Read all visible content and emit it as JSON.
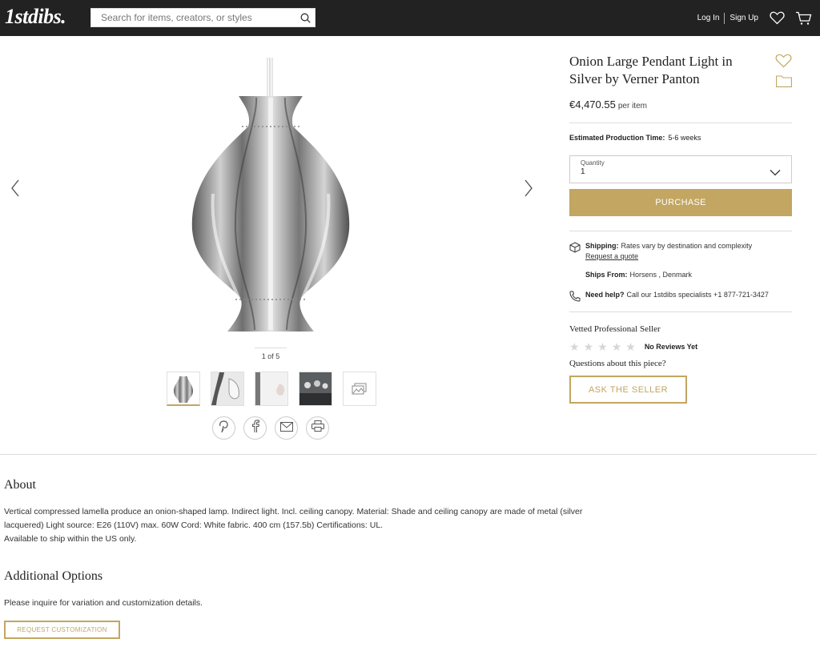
{
  "header": {
    "logo": "1stdibs.",
    "search_placeholder": "Search for items, creators, or styles",
    "login": "Log In",
    "signup": "Sign Up"
  },
  "gallery": {
    "counter": "1 of 5",
    "thumbnails": [
      "thumbnail-1",
      "thumbnail-2",
      "thumbnail-3",
      "thumbnail-4",
      "more-images"
    ],
    "share": [
      "pinterest-icon",
      "facebook-icon",
      "email-icon",
      "print-icon"
    ]
  },
  "product": {
    "title": "Onion Large Pendant Light in Silver by Verner Panton",
    "price": "€4,470.55",
    "price_unit": "per item",
    "production_label": "Estimated Production Time:",
    "production_value": "5-6 weeks",
    "quantity_label": "Quantity",
    "quantity_value": "1",
    "purchase_label": "PURCHASE"
  },
  "shipping": {
    "shipping_label": "Shipping:",
    "shipping_value": "Rates vary by destination and complexity",
    "quote_link": "Request a quote",
    "ships_from_label": "Ships From:",
    "ships_from_value": "Horsens , Denmark",
    "help_label": "Need help?",
    "help_value": "Call our 1stdibs specialists +1 877-721-3427"
  },
  "seller": {
    "vetted": "Vetted Professional Seller",
    "rating": 0,
    "reviews": "No Reviews Yet",
    "questions": "Questions about this piece?",
    "ask_label": "ASK THE SELLER"
  },
  "about": {
    "heading": "About",
    "line1": "Vertical compressed lamella produce an onion-shaped lamp. Indirect light. Incl. ceiling canopy. Material: Shade and ceiling canopy are made of metal (silver",
    "line2": "lacquered) Light source: E26 (110V) max. 60W Cord: White fabric. 400 cm (157.5b) Certifications: UL.",
    "line3": "Available to ship within the US only."
  },
  "options": {
    "heading": "Additional Options",
    "text": "Please inquire for variation and customization details.",
    "button": "REQUEST CUSTOMIZATION"
  },
  "colors": {
    "accent": "#c2a661",
    "header_bg": "#222222"
  }
}
